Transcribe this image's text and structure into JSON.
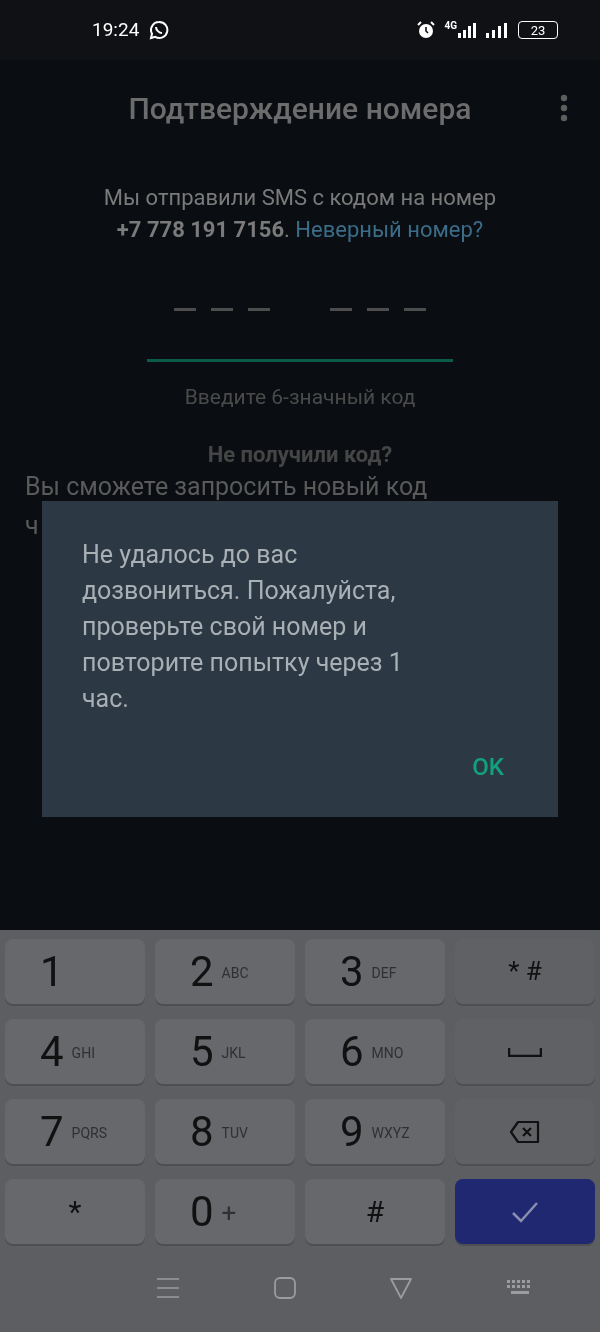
{
  "status_bar": {
    "time": "19:24",
    "network": "4G",
    "battery": "23"
  },
  "title": "Подтверждение номера",
  "message": {
    "text": "Мы отправили SMS с кодом на номер **+7 778 191 7156**.",
    "link": "Неверный номер?"
  },
  "code_field": {
    "hint": "Введите 6-значный код"
  },
  "resend": {
    "heading": "Не получили код?",
    "line_1": "Вы сможете запросить новый код",
    "line_2": "ч"
  },
  "dialog": {
    "message": "Не удалось до вас дозвониться. Пожалуйста, проверьте свой номер и повторите попытку через 1 час.",
    "button": "OK"
  },
  "keyboard": [
    {
      "kind": "digit",
      "main": "1"
    },
    {
      "kind": "digit",
      "main": "2",
      "sub": "ABC"
    },
    {
      "kind": "digit",
      "main": "3",
      "sub": "DEF"
    },
    {
      "kind": "symbols",
      "main": "* #"
    },
    {
      "kind": "digit",
      "main": "4",
      "sub": "GHI"
    },
    {
      "kind": "digit",
      "main": "5",
      "sub": "JKL"
    },
    {
      "kind": "digit",
      "main": "6",
      "sub": "MNO"
    },
    {
      "kind": "space"
    },
    {
      "kind": "digit",
      "main": "7",
      "sub": "PQRS"
    },
    {
      "kind": "digit",
      "main": "8",
      "sub": "TUV"
    },
    {
      "kind": "digit",
      "main": "9",
      "sub": "WXYZ"
    },
    {
      "kind": "backspace"
    },
    {
      "kind": "symbol",
      "main": "*"
    },
    {
      "kind": "digit",
      "main": "0",
      "sub": "+"
    },
    {
      "kind": "symbol",
      "main": "#"
    },
    {
      "kind": "enter"
    }
  ]
}
